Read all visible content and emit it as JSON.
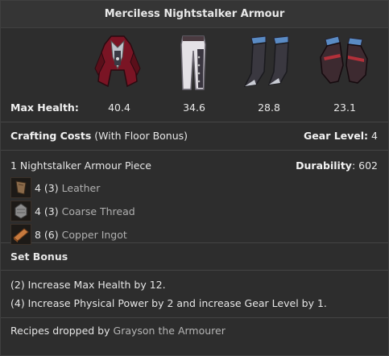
{
  "title": "Merciless Nightstalker Armour",
  "items": [
    {
      "icon": "chest-armour-icon",
      "max_health": "40.4"
    },
    {
      "icon": "leggings-icon",
      "max_health": "34.6"
    },
    {
      "icon": "boots-icon",
      "max_health": "28.8"
    },
    {
      "icon": "gloves-icon",
      "max_health": "23.1"
    }
  ],
  "max_health_label": "Max Health:",
  "crafting": {
    "label": "Crafting Costs",
    "note": "(With Floor Bonus)",
    "gear_level_label": "Gear Level:",
    "gear_level_value": "4"
  },
  "materials": {
    "piece": "1 Nightstalker Armour Piece",
    "durability_label": "Durability",
    "durability_value": ": 602",
    "list": [
      {
        "qty": "4 (3)",
        "name": "Leather",
        "icon": "leather-icon"
      },
      {
        "qty": "4 (3)",
        "name": "Coarse Thread",
        "icon": "coarse-thread-icon"
      },
      {
        "qty": "8 (6)",
        "name": "Copper Ingot",
        "icon": "copper-ingot-icon"
      }
    ]
  },
  "set_bonus": {
    "title": "Set Bonus",
    "lines": [
      "(2) Increase Max Health by 12.",
      "(4) Increase Physical Power by 2 and increase Gear Level by 1."
    ]
  },
  "footer": {
    "prefix": "Recipes dropped by",
    "npc": "Grayson the Armourer"
  }
}
